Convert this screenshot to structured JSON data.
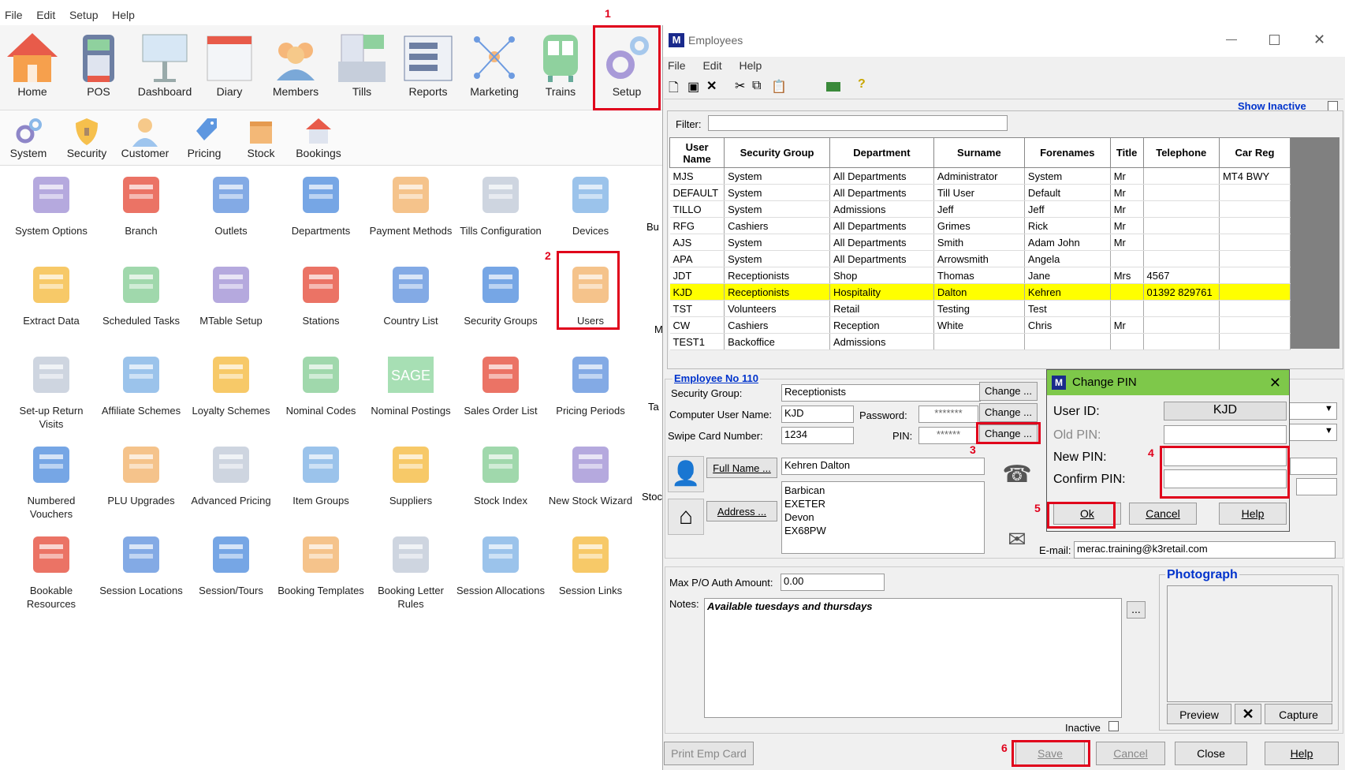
{
  "menubar": [
    "File",
    "Edit",
    "Setup",
    "Help"
  ],
  "ribbon": [
    "Home",
    "POS",
    "Dashboard",
    "Diary",
    "Members",
    "Tills",
    "Reports",
    "Marketing",
    "Trains",
    "Setup"
  ],
  "ribbon2": [
    "System",
    "Security",
    "Customer",
    "Pricing",
    "Stock",
    "Bookings"
  ],
  "grid": [
    [
      "System Options",
      "Branch",
      "Outlets",
      "Departments",
      "Payment Methods",
      "Tills Configuration",
      "Devices"
    ],
    [
      "Extract Data",
      "Scheduled Tasks",
      "MTable Setup",
      "Stations",
      "Country List",
      "Security Groups",
      "Users"
    ],
    [
      "Set-up Return Visits",
      "Affiliate Schemes",
      "Loyalty Schemes",
      "Nominal Codes",
      "Nominal Postings",
      "Sales Order List",
      "Pricing Periods"
    ],
    [
      "Numbered Vouchers",
      "PLU Upgrades",
      "Advanced Pricing",
      "Item Groups",
      "Suppliers",
      "Stock Index",
      "New Stock Wizard"
    ],
    [
      "Bookable Resources",
      "Session Locations",
      "Session/Tours",
      "Booking Templates",
      "Booking Letter Rules",
      "Session Allocations",
      "Session Links"
    ]
  ],
  "grid_cut": [
    "Bu",
    "M",
    "Ta",
    "Stoc"
  ],
  "sage_label": "SAGE",
  "annotations": [
    "1",
    "2",
    "3",
    "4",
    "5",
    "6"
  ],
  "window": {
    "app_icon": "M",
    "title": "Employees",
    "menu": [
      "File",
      "Edit",
      "Help"
    ],
    "show_inactive": "Show Inactive",
    "filter_label": "Filter:",
    "table": {
      "headers": [
        "User Name",
        "Security Group",
        "Department",
        "Surname",
        "Forenames",
        "Title",
        "Telephone",
        "Car Reg"
      ],
      "rows": [
        [
          "MJS",
          "System",
          "All Departments",
          "Administrator",
          "System",
          "Mr",
          "",
          "MT4 BWY"
        ],
        [
          "DEFAULT",
          "System",
          "All Departments",
          "Till User",
          "Default",
          "Mr",
          "",
          ""
        ],
        [
          "TILLO",
          "System",
          "Admissions",
          "Jeff",
          "Jeff",
          "Mr",
          "",
          ""
        ],
        [
          "RFG",
          "Cashiers",
          "All Departments",
          "Grimes",
          "Rick",
          "Mr",
          "",
          ""
        ],
        [
          "AJS",
          "System",
          "All Departments",
          "Smith",
          "Adam John",
          "Mr",
          "",
          ""
        ],
        [
          "APA",
          "System",
          "All Departments",
          "Arrowsmith",
          "Angela",
          "",
          "",
          ""
        ],
        [
          "JDT",
          "Receptionists",
          "Shop",
          "Thomas",
          "Jane",
          "Mrs",
          "4567",
          ""
        ],
        [
          "KJD",
          "Receptionists",
          "Hospitality",
          "Dalton",
          "Kehren",
          "",
          "01392 829761",
          ""
        ],
        [
          "TST",
          "Volunteers",
          "Retail",
          "Testing",
          "Test",
          "",
          "",
          ""
        ],
        [
          "CW",
          "Cashiers",
          "Reception",
          "White",
          "Chris",
          "Mr",
          "",
          ""
        ],
        [
          "TEST1",
          "Backoffice",
          "Admissions",
          "",
          "",
          "",
          "",
          ""
        ]
      ]
    },
    "employee_no": "Employee No 110",
    "security_group_label": "Security Group:",
    "security_group": "Receptionists",
    "computer_user_label": "Computer User Name:",
    "computer_user": "KJD",
    "password_label": "Password:",
    "password_mask": "*******",
    "swipe_label": "Swipe Card Number:",
    "swipe": "1234",
    "pin_label": "PIN:",
    "pin_mask": "******",
    "change_label": "Change ...",
    "fullname_btn": "Full Name ...",
    "fullname": "Kehren Dalton",
    "address_btn": "Address ...",
    "address": [
      "Barbican",
      "EXETER",
      "Devon",
      "EX68PW"
    ],
    "email_label": "E-mail:",
    "email": "merac.training@k3retail.com",
    "max_po_label": "Max P/O Auth Amount:",
    "max_po": "0.00",
    "notes_label": "Notes:",
    "notes": "Available tuesdays and thursdays",
    "notes_btn": "...",
    "photograph": "Photograph",
    "preview": "Preview",
    "capture": "Capture",
    "inactive": "Inactive",
    "print_card": "Print Emp Card",
    "save": "Save",
    "cancel": "Cancel",
    "close": "Close",
    "help": "Help"
  },
  "dialog": {
    "title": "Change PIN",
    "user_id_label": "User ID:",
    "user_id": "KJD",
    "old_pin_label": "Old PIN:",
    "new_pin_label": "New PIN:",
    "confirm_pin_label": "Confirm PIN:",
    "ok": "Ok",
    "cancel": "Cancel",
    "help": "Help"
  },
  "colors": {
    "accent_red": "#e0001b",
    "selected_row": "#ffff00",
    "dialog_title": "#7ec84a",
    "link": "#0033cc"
  }
}
